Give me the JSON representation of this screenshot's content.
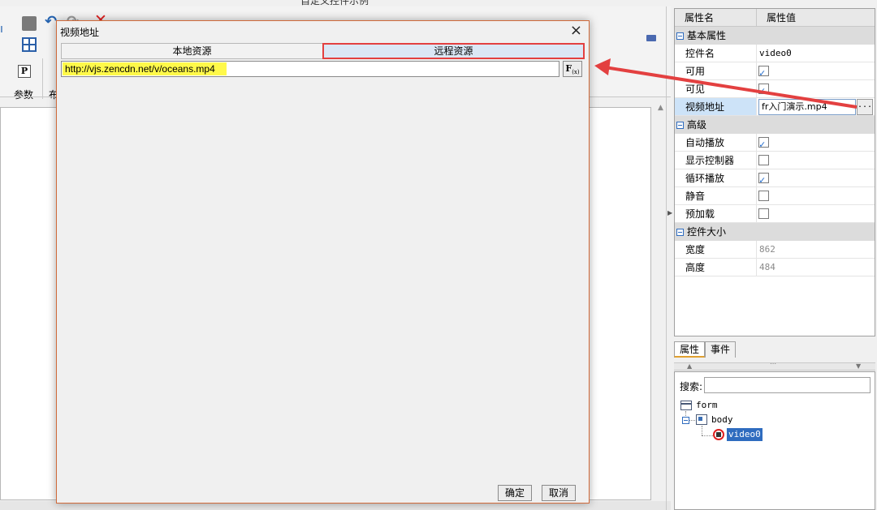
{
  "app": {
    "title": "自定义控件示例"
  },
  "toolbar": {
    "param_label": "参数",
    "cut_label": "布"
  },
  "properties": {
    "header_name": "属性名",
    "header_value": "属性值",
    "groups": {
      "basic": "基本属性",
      "advanced": "高级",
      "size": "控件大小"
    },
    "rows": {
      "control_name": {
        "name": "控件名",
        "value": "video0"
      },
      "enabled": {
        "name": "可用",
        "checked": true
      },
      "visible": {
        "name": "可见",
        "checked": true
      },
      "video_url": {
        "name": "视频地址",
        "value": "fr入门演示.mp4",
        "button": "..."
      },
      "autoplay": {
        "name": "自动播放",
        "checked": true
      },
      "controls": {
        "name": "显示控制器",
        "checked": false
      },
      "loop": {
        "name": "循环播放",
        "checked": true
      },
      "mute": {
        "name": "静音",
        "checked": false
      },
      "preload": {
        "name": "预加载",
        "checked": false
      },
      "width": {
        "name": "宽度",
        "value": "862"
      },
      "height": {
        "name": "高度",
        "value": "484"
      }
    }
  },
  "bottom_tabs": {
    "properties": "属性",
    "events": "事件"
  },
  "tree": {
    "search_label": "搜索:",
    "search_value": "",
    "nodes": {
      "form": "form",
      "body": "body",
      "video": "video0"
    }
  },
  "dialog": {
    "title": "视频地址",
    "close_glyph": "×",
    "tabs": {
      "local": "本地资源",
      "remote": "远程资源"
    },
    "url_value": "http://vjs.zencdn.net/v/oceans.mp4",
    "fx_label": "F",
    "fx_sub": "(x)",
    "ok_label": "确定",
    "cancel_label": "取消"
  },
  "colors": {
    "highlight": "#fff94a",
    "annotation": "#e34040",
    "selection": "#2f6cbf",
    "checkbox": "#1a66c9"
  }
}
